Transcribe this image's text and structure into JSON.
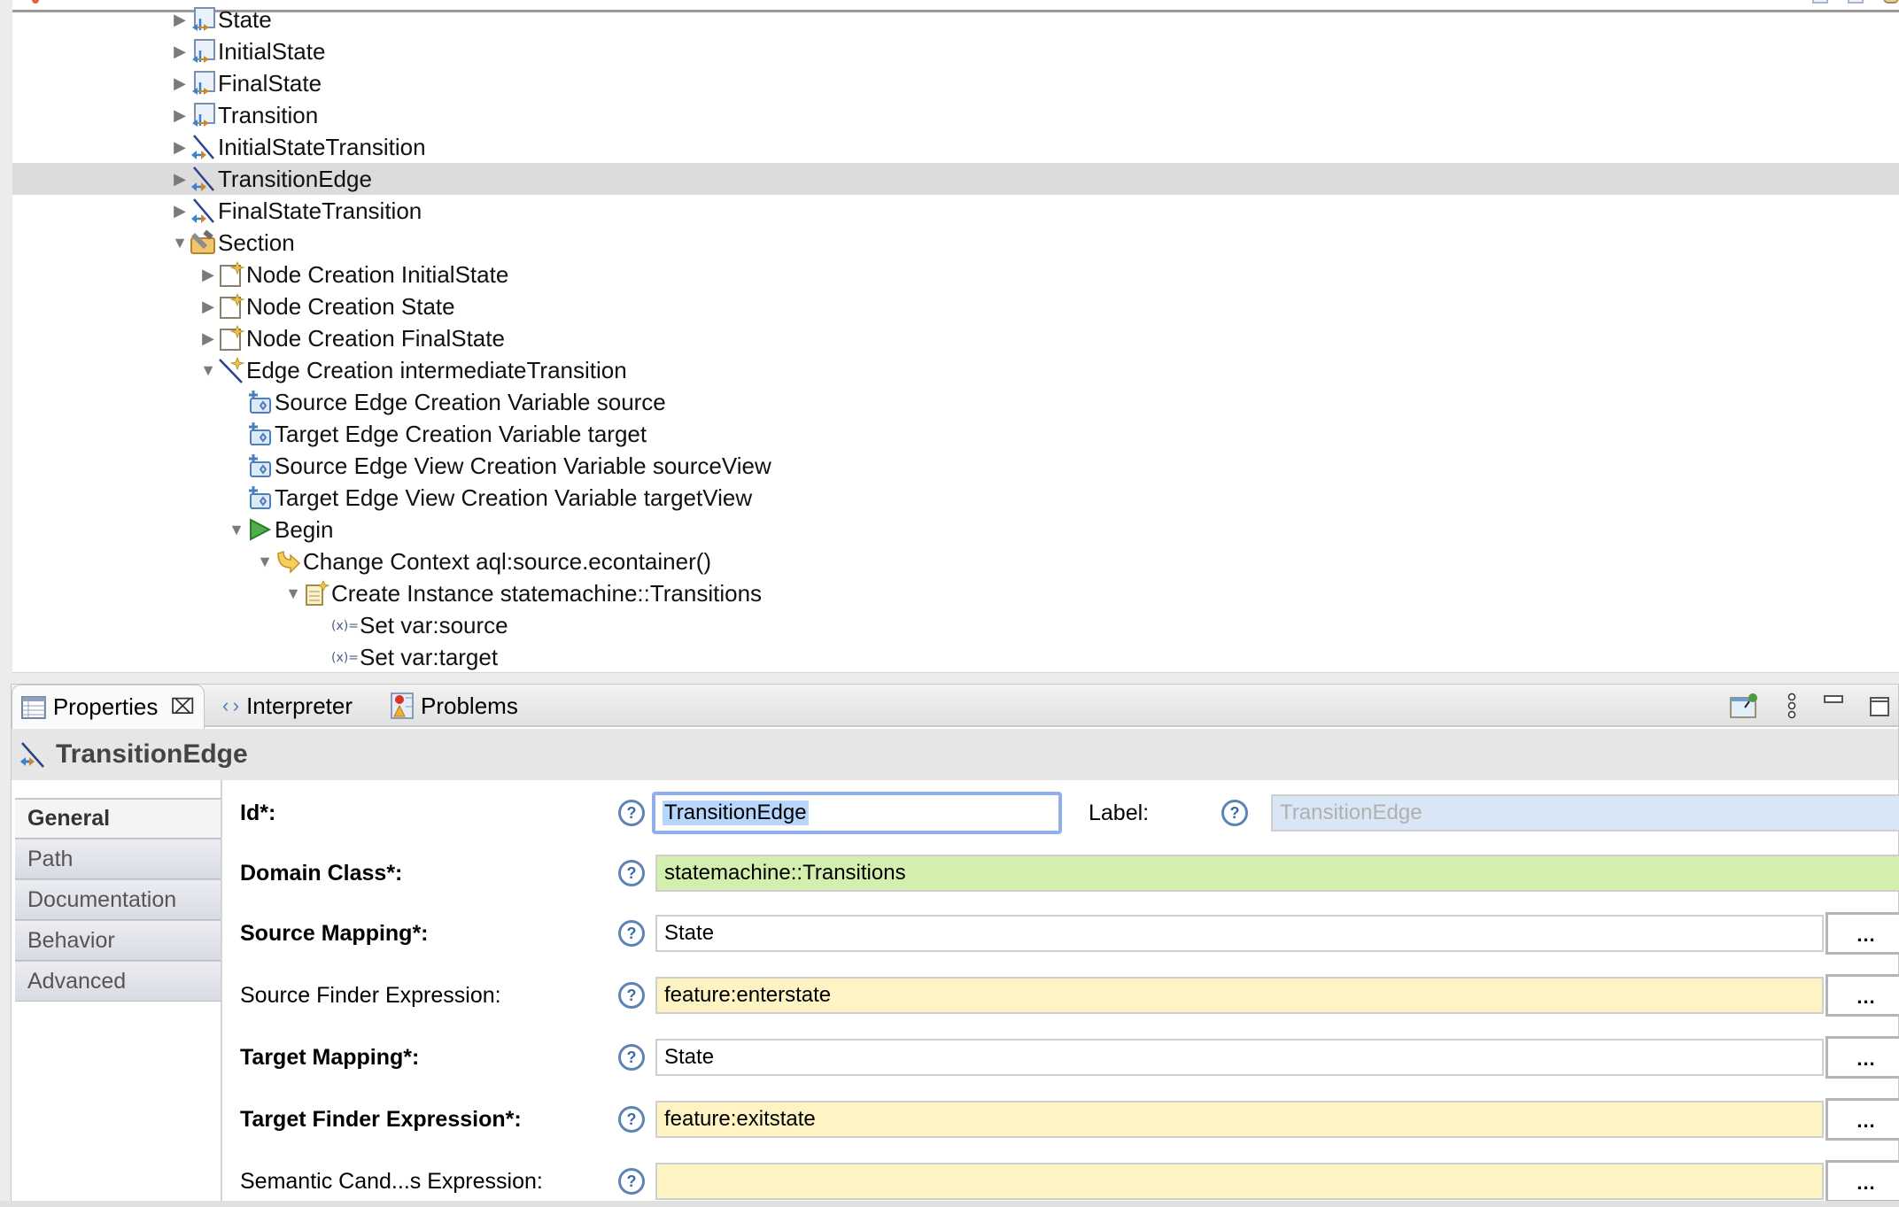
{
  "tree": {
    "items": [
      {
        "label": "State",
        "icon": "node-mapping-icon",
        "expander": "collapsed",
        "level": 0
      },
      {
        "label": "InitialState",
        "icon": "node-mapping-icon",
        "expander": "collapsed",
        "level": 0
      },
      {
        "label": "FinalState",
        "icon": "node-mapping-icon",
        "expander": "collapsed",
        "level": 0
      },
      {
        "label": "Transition",
        "icon": "node-mapping-icon",
        "expander": "collapsed",
        "level": 0
      },
      {
        "label": "InitialStateTransition",
        "icon": "edge-mapping-icon",
        "expander": "collapsed",
        "level": 0
      },
      {
        "label": "TransitionEdge",
        "icon": "edge-mapping-icon",
        "expander": "collapsed",
        "level": 0,
        "selected": true
      },
      {
        "label": "FinalStateTransition",
        "icon": "edge-mapping-icon",
        "expander": "collapsed",
        "level": 0
      },
      {
        "label": "Section",
        "icon": "section-tools-icon",
        "expander": "expanded",
        "level": 0
      },
      {
        "label": "Node Creation InitialState",
        "icon": "node-creation-icon",
        "expander": "collapsed",
        "level": 1
      },
      {
        "label": "Node Creation State",
        "icon": "node-creation-icon",
        "expander": "collapsed",
        "level": 1
      },
      {
        "label": "Node Creation FinalState",
        "icon": "node-creation-icon",
        "expander": "collapsed",
        "level": 1
      },
      {
        "label": "Edge Creation intermediateTransition",
        "icon": "edge-creation-icon",
        "expander": "expanded",
        "level": 1
      },
      {
        "label": "Source Edge Creation Variable source",
        "icon": "variable-icon",
        "expander": "none",
        "level": 2
      },
      {
        "label": "Target Edge Creation Variable target",
        "icon": "variable-icon",
        "expander": "none",
        "level": 2
      },
      {
        "label": "Source Edge View Creation Variable sourceView",
        "icon": "variable-icon",
        "expander": "none",
        "level": 2
      },
      {
        "label": "Target Edge View Creation Variable targetView",
        "icon": "variable-icon",
        "expander": "none",
        "level": 2
      },
      {
        "label": "Begin",
        "icon": "begin-play-icon",
        "expander": "expanded",
        "level": 2
      },
      {
        "label": "Change Context aql:source.econtainer()",
        "icon": "change-context-icon",
        "expander": "expanded",
        "level": 3
      },
      {
        "label": "Create Instance statemachine::Transitions",
        "icon": "create-instance-icon",
        "expander": "expanded",
        "level": 4
      },
      {
        "label": "Set var:source",
        "icon": "set-variable-icon",
        "expander": "none",
        "level": 5
      },
      {
        "label": "Set var:target",
        "icon": "set-variable-icon",
        "expander": "none",
        "level": 5
      }
    ]
  },
  "properties": {
    "tabs": [
      {
        "label": "Properties",
        "icon": "properties-table-icon",
        "active": true,
        "closable": true
      },
      {
        "label": "Interpreter",
        "icon": "interpreter-brackets-icon",
        "active": false
      },
      {
        "label": "Problems",
        "icon": "problems-icon",
        "active": false
      }
    ],
    "toolbar": [
      "pin-icon",
      "view-menu-icon",
      "minimize-icon",
      "maximize-icon"
    ],
    "title": "TransitionEdge",
    "side_tabs": [
      {
        "label": "General",
        "active": true
      },
      {
        "label": "Path",
        "active": false
      },
      {
        "label": "Documentation",
        "active": false
      },
      {
        "label": "Behavior",
        "active": false
      },
      {
        "label": "Advanced",
        "active": false
      }
    ],
    "help_glyph": "?",
    "browse_label": "...",
    "fields": {
      "id": {
        "label": "Id*:",
        "value": "TransitionEdge"
      },
      "label": {
        "label": "Label:",
        "value": "TransitionEdge"
      },
      "domain_class": {
        "label": "Domain Class*:",
        "value": "statemachine::Transitions"
      },
      "source_mapping": {
        "label": "Source Mapping*:",
        "value": "State"
      },
      "source_finder": {
        "label": "Source Finder Expression:",
        "value": "feature:enterstate"
      },
      "target_mapping": {
        "label": "Target Mapping*:",
        "value": "State"
      },
      "target_finder": {
        "label": "Target Finder Expression*:",
        "value": "feature:exitstate"
      },
      "semantic_candidates": {
        "label": "Semantic Cand...s Expression:",
        "value": ""
      }
    }
  },
  "colors": {
    "selection_row": "#dcdcdc",
    "focus_border": "#8fb0ec",
    "text_selection": "#b8d6fb",
    "domain_class_bg": "#d3efae",
    "expression_bg": "#fdf3c3",
    "disabled_bg": "#d9e6f6"
  }
}
